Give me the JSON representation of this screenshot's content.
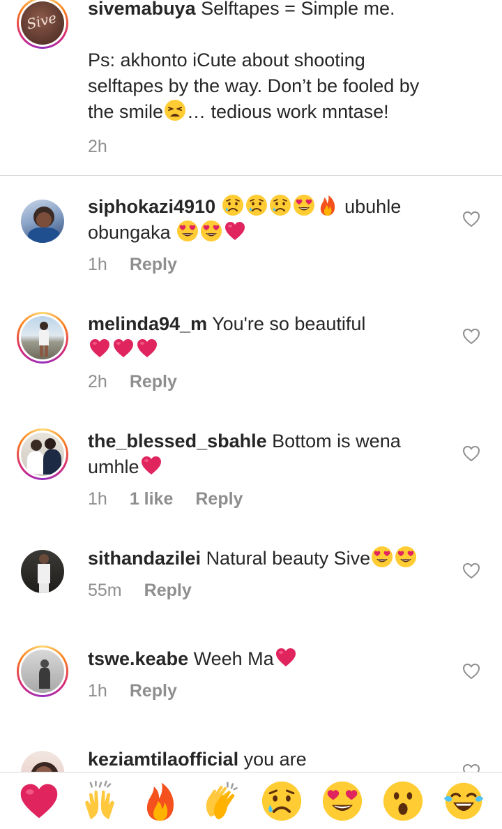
{
  "caption": {
    "username": "sivemabuya",
    "line1": "Selftapes = Simple me.",
    "line2": "Ps: akhonto iCute about shooting",
    "line3": "selftapes by the way. Don’t be fooled by",
    "line4_start": "the smile",
    "line4_end": "… tedious work mntase!",
    "time": "2h",
    "avatar_text": "Sive"
  },
  "comments": [
    {
      "username": "siphokazi4910",
      "text_a": "ubuhle",
      "text_b": "obungaka",
      "time": "1h",
      "likes": "",
      "reply": "Reply"
    },
    {
      "username": "melinda94_m",
      "text_a": "You're so beautiful",
      "time": "2h",
      "likes": "",
      "reply": "Reply"
    },
    {
      "username": "the_blessed_sbahle",
      "text_a": "Bottom is wena",
      "text_b": "umhle",
      "time": "1h",
      "likes": "1 like",
      "reply": "Reply"
    },
    {
      "username": "sithandazilei",
      "text_a": "Natural beauty Sive",
      "time": "55m",
      "likes": "",
      "reply": "Reply"
    },
    {
      "username": "tswe.keabe",
      "text_a": "Weeh Ma",
      "time": "1h",
      "likes": "",
      "reply": "Reply"
    },
    {
      "username": "keziamtilaofficial",
      "text_a": "you are"
    }
  ],
  "reaction_bar": [
    "heart",
    "raising-hands",
    "fire",
    "clapping-hands",
    "sad-tear",
    "heart-eyes",
    "surprised",
    "tears-of-joy"
  ],
  "colors": {
    "meta_gray": "#8e8e8e",
    "heart_red": "#e0245e",
    "divider": "#dbdbdb"
  }
}
